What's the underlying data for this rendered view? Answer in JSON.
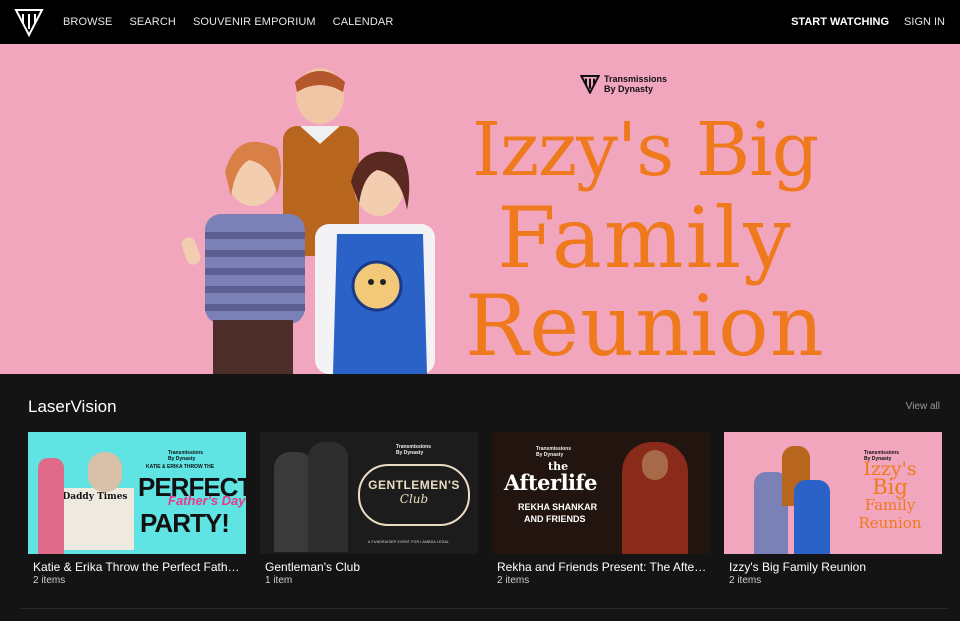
{
  "nav": {
    "links": [
      "BROWSE",
      "SEARCH",
      "SOUVENIR EMPORIUM",
      "CALENDAR"
    ],
    "start_watching": "START WATCHING",
    "sign_in": "SIGN IN"
  },
  "hero": {
    "brand_line1": "Transmissions",
    "brand_line2": "By Dynasty",
    "title_line1": "Izzy's Big",
    "title_line2": "Family",
    "title_line3": "Reunion"
  },
  "section": {
    "title": "LaserVision",
    "view_all": "View all"
  },
  "cards": [
    {
      "title": "Katie & Erika Throw the Perfect Father's Day ...",
      "count": "2 items",
      "poster_line1": "PERFECT",
      "poster_line2": "PARTY!",
      "poster_script": "Father's Day",
      "poster_top": "KATIE & ERIKA THROW THE",
      "poster_paper": "Daddy Times"
    },
    {
      "title": "Gentleman's Club",
      "count": "1 item",
      "poster_line1": "GENTLEMEN'S",
      "poster_line2": "Club",
      "poster_bottom": "A FUNDRAISER EVENT FOR LAMBDA LEGAL"
    },
    {
      "title": "Rekha and Friends Present: The Afterlife",
      "count": "2 items",
      "poster_line0": "the",
      "poster_line1": "Afterlife",
      "poster_line2": "REKHA SHANKAR",
      "poster_line3": "AND FRIENDS"
    },
    {
      "title": "Izzy's Big Family Reunion",
      "count": "2 items",
      "poster_line1": "Izzy's",
      "poster_line2": "Big",
      "poster_line3": "Family",
      "poster_line4": "Reunion"
    }
  ],
  "mini_brand": {
    "line1": "Transmissions",
    "line2": "By Dynasty"
  },
  "colors": {
    "nav_bg": "#000000",
    "page_bg": "#141414",
    "hero_bg": "#f1a6bd",
    "hero_title": "#ef7a1e",
    "card1_bg": "#5fe3e3",
    "card4_bg": "#f1a6bd"
  }
}
